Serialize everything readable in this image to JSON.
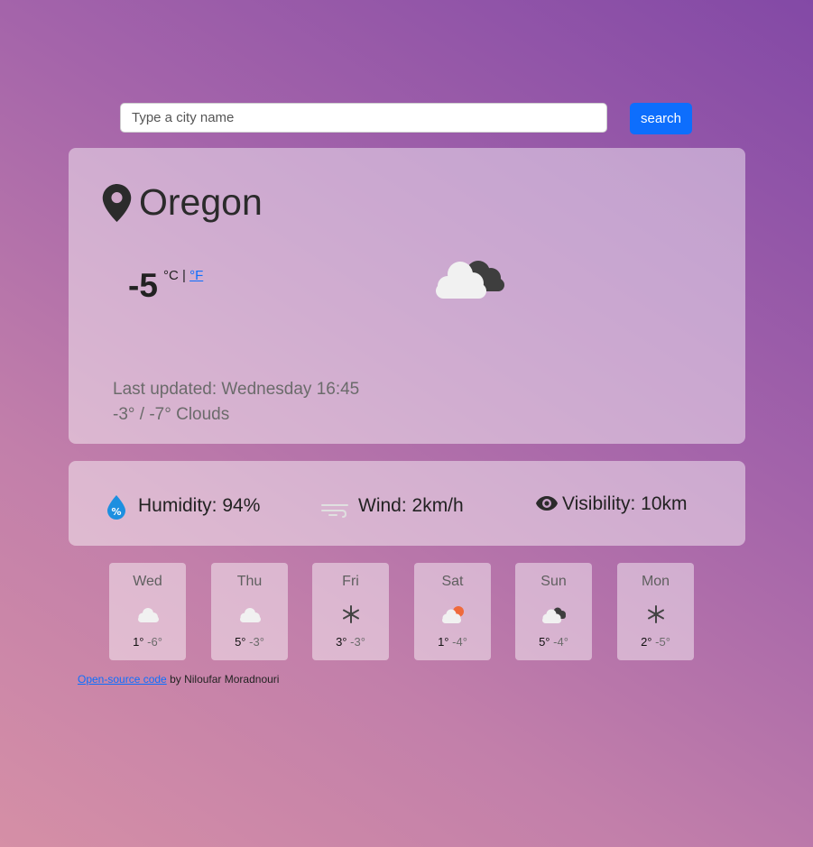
{
  "search": {
    "placeholder": "Type a city name",
    "button_label": "search"
  },
  "current": {
    "city": "Oregon",
    "temperature": "-5",
    "unit_c": "°C",
    "separator": " | ",
    "unit_f": "°F",
    "icon": "clouds-icon",
    "last_updated": "Last updated: Wednesday 16:45",
    "range_desc": "-3° / -7° Clouds"
  },
  "details": {
    "humidity": "Humidity: 94%",
    "wind": "Wind: 2km/h",
    "visibility": "Visibility: 10km"
  },
  "forecast": [
    {
      "day": "Wed",
      "max": "1°",
      "min": "-6°",
      "icon": "cloud-icon"
    },
    {
      "day": "Thu",
      "max": "5°",
      "min": "-3°",
      "icon": "cloud-icon"
    },
    {
      "day": "Fri",
      "max": "3°",
      "min": "-3°",
      "icon": "snowflake-icon"
    },
    {
      "day": "Sat",
      "max": "1°",
      "min": "-4°",
      "icon": "sun-cloud-icon"
    },
    {
      "day": "Sun",
      "max": "5°",
      "min": "-4°",
      "icon": "clouds-icon"
    },
    {
      "day": "Mon",
      "max": "2°",
      "min": "-5°",
      "icon": "snowflake-icon"
    }
  ],
  "footer": {
    "link_text": "Open-source code",
    "author_text": " by Niloufar Moradnouri"
  },
  "colors": {
    "accent": "#0d6efd",
    "card": "rgba(255,255,255,0.45)"
  }
}
